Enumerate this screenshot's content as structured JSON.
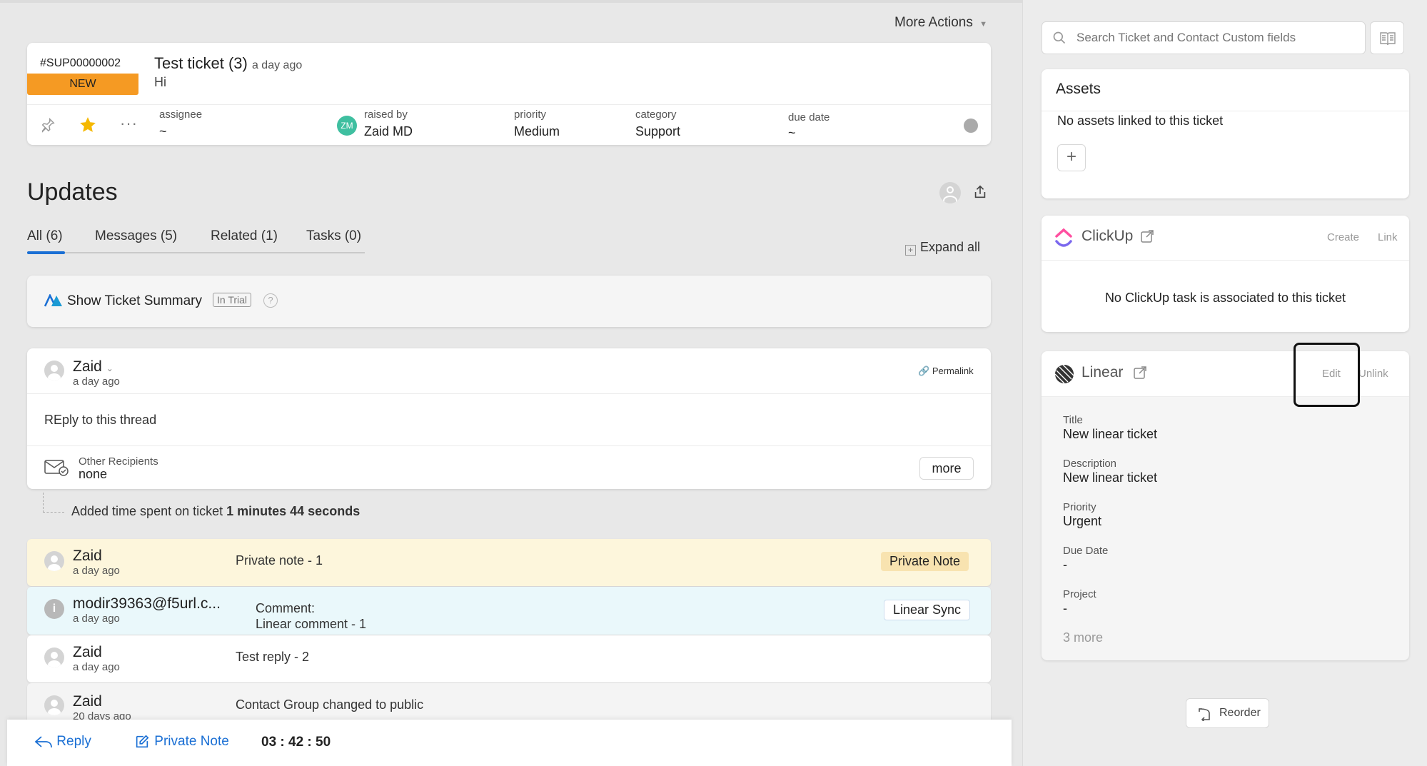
{
  "header": {
    "more_actions": "More Actions"
  },
  "ticket": {
    "id": "#SUP00000002",
    "status": "NEW",
    "title": "Test ticket",
    "count": "(3)",
    "time": "a day ago",
    "body": "Hi",
    "assignee_label": "assignee",
    "assignee_value": "~",
    "raised_label": "raised by",
    "raised_initials": "ZM",
    "raised_value": "Zaid MD",
    "priority_label": "priority",
    "priority_value": "Medium",
    "category_label": "category",
    "category_value": "Support",
    "due_label": "due date",
    "due_value": "~"
  },
  "updates": {
    "heading": "Updates",
    "tabs": [
      {
        "label": "All (6)"
      },
      {
        "label": "Messages (5)"
      },
      {
        "label": "Related (1)"
      },
      {
        "label": "Tasks (0)"
      }
    ],
    "expand_all": "Expand all",
    "summary_label": "Show Ticket Summary",
    "trial_badge": "In Trial",
    "help": "?"
  },
  "thread": {
    "author": "Zaid",
    "time": "a day ago",
    "permalink": "Permalink",
    "body": "REply to this thread",
    "recipients_label": "Other Recipients",
    "recipients_value": "none",
    "more": "more"
  },
  "time_entry": {
    "text": "Added time spent on ticket ",
    "bold": "1 minutes 44 seconds"
  },
  "activity": [
    {
      "author": "Zaid",
      "time": "a day ago",
      "text": "Private note - 1",
      "badge": "Private Note"
    },
    {
      "author": "modir39363@f5url.c...",
      "time": "a day ago",
      "text_line1": "Comment:",
      "text_line2": "Linear comment - 1",
      "badge": "Linear Sync"
    },
    {
      "author": "Zaid",
      "time": "a day ago",
      "text": "Test reply - 2"
    },
    {
      "author": "Zaid",
      "time": "20 days ago",
      "text": "Contact Group changed to public"
    }
  ],
  "bottom_bar": {
    "reply": "Reply",
    "private_note": "Private Note",
    "timer": "03 : 42 : 50"
  },
  "sidebar": {
    "search_placeholder": "Search Ticket and Contact Custom fields",
    "assets": {
      "title": "Assets",
      "empty": "No assets linked to this ticket",
      "add": "+"
    },
    "clickup": {
      "title": "ClickUp",
      "create": "Create",
      "link": "Link",
      "empty": "No ClickUp task is associated to this ticket"
    },
    "linear": {
      "title": "Linear",
      "edit": "Edit",
      "unlink": "Unlink",
      "fields": [
        {
          "label": "Title",
          "value": "New linear ticket"
        },
        {
          "label": "Description",
          "value": "New linear ticket"
        },
        {
          "label": "Priority",
          "value": "Urgent"
        },
        {
          "label": "Due Date",
          "value": "-"
        },
        {
          "label": "Project",
          "value": "-"
        }
      ],
      "more": "3 more"
    },
    "reorder": "Reorder"
  },
  "colors": {
    "accent": "#1a6fd4",
    "status_new": "#f59a23",
    "private_note_bg": "#fdf6dc",
    "linear_sync_bg": "#eaf8fb"
  }
}
